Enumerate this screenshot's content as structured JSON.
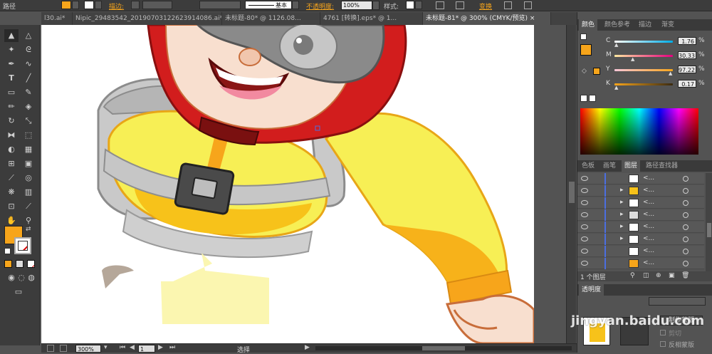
{
  "control_bar": {
    "object_label": "路径",
    "stroke_label": "描边:",
    "brush_label": "基本",
    "opacity_label": "不透明度:",
    "opacity_value": "100%",
    "style_label": "样式:",
    "transform_label": "变换",
    "fill_color": "#f7a51b"
  },
  "tabs": [
    {
      "label": "l30.ai*"
    },
    {
      "label": "Nipic_29483542_20190703122623914086.ai*"
    },
    {
      "label": "未标题-80* @ 1126.08..."
    },
    {
      "label": "4761 [转换].eps* @ 1..."
    },
    {
      "label": "未标题-81* @ 300% (CMYK/预览)"
    }
  ],
  "color_panel": {
    "tabs": [
      "颜色",
      "颜色参考",
      "描边",
      "渐变"
    ],
    "channels": [
      {
        "label": "C",
        "value": "1.76",
        "percent": "%"
      },
      {
        "label": "M",
        "value": "30.33",
        "percent": "%"
      },
      {
        "label": "Y",
        "value": "97.22",
        "percent": "%"
      },
      {
        "label": "K",
        "value": "0.17",
        "percent": "%"
      }
    ],
    "fill_color": "#f7a51b"
  },
  "layers_panel": {
    "tabs": [
      "色板",
      "画笔",
      "图层",
      "路径查找器"
    ],
    "rows": [
      {
        "name": "<..."
      },
      {
        "name": "<..."
      },
      {
        "name": "<..."
      },
      {
        "name": "<..."
      },
      {
        "name": "<..."
      },
      {
        "name": "<..."
      },
      {
        "name": "<..."
      },
      {
        "name": "<..."
      }
    ],
    "footer": "1 个图层"
  },
  "transparency_panel": {
    "tab": "透明度",
    "make_mask_button": "制作蒙版",
    "clip_label": "剪切",
    "invert_mask_label": "反相蒙版"
  },
  "status_bar": {
    "zoom": "300%",
    "page": "1",
    "tool_status": "选择"
  },
  "toolbar": {
    "fill_color": "#f7a51b"
  },
  "watermark": "jingyan.baidu.com"
}
